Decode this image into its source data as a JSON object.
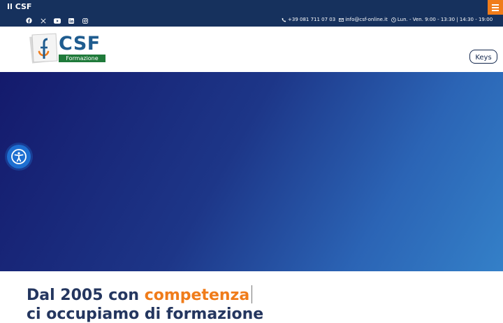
{
  "site": {
    "title": "Il CSF"
  },
  "colors": {
    "navy": "#16315d",
    "orange": "#f07c1a",
    "hero_start": "#141a6c",
    "hero_end": "#3480c8",
    "accessibility_blue": "#1e6fd1",
    "logo_green": "#1f7a3a"
  },
  "menu": {
    "icon": "hamburger-menu-icon"
  },
  "social": [
    {
      "name": "facebook-icon"
    },
    {
      "name": "x-twitter-icon"
    },
    {
      "name": "youtube-icon"
    },
    {
      "name": "linkedin-icon"
    },
    {
      "name": "instagram-icon"
    }
  ],
  "contacts": {
    "phone": "+39 081 711 07 03",
    "email": "info@csf-online.it",
    "hours": "Lun. - Ven. 9:00 - 13:30 | 14:30 - 19:00"
  },
  "logo": {
    "text": "CSF",
    "subtitle": "Formazione"
  },
  "keys_button": {
    "label": "Keys"
  },
  "accessibility": {
    "icon": "accessibility-icon"
  },
  "headline": {
    "prefix": "Dal 2005 con",
    "accent": "competenza",
    "line2": "ci occupiamo di formazione"
  }
}
